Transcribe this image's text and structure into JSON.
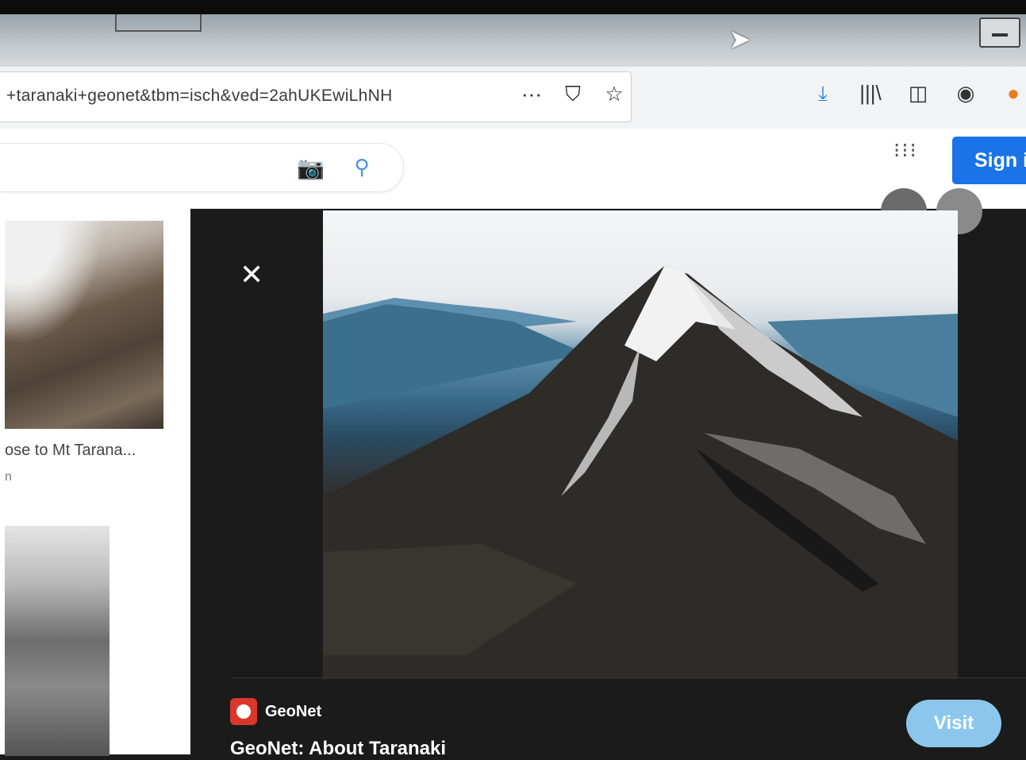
{
  "browser": {
    "url": "+taranaki+geonet&tbm=isch&ved=2ahUKEwiLhNH",
    "url_actions": [
      {
        "name": "more-icon",
        "glyph": "···"
      },
      {
        "name": "pocket-icon",
        "glyph": "⛉"
      },
      {
        "name": "bookmark-star-icon",
        "glyph": "☆"
      }
    ],
    "toolbar_icons": [
      {
        "name": "download-icon",
        "glyph": "⤓"
      },
      {
        "name": "library-icon",
        "glyph": "|||\\"
      },
      {
        "name": "sidebar-icon",
        "glyph": "◫"
      },
      {
        "name": "account-icon",
        "glyph": "◉"
      },
      {
        "name": "profile-icon",
        "glyph": "●"
      }
    ]
  },
  "google": {
    "camera_icon": "📷",
    "search_icon": "⚲",
    "apps_icon": "⁝⁝⁝",
    "sign_in_label": "Sign in"
  },
  "results": {
    "first": {
      "title": "ose to Mt Tarana...",
      "source": "n"
    }
  },
  "viewer": {
    "close_glyph": "✕",
    "source_name": "GeoNet",
    "title": "GeoNet: About Taranaki",
    "visit_label": "Visit"
  },
  "colors": {
    "sign_in_blue": "#1a73e8",
    "visit_blue": "#8cc6ec",
    "geonet_red": "#d9372b"
  }
}
